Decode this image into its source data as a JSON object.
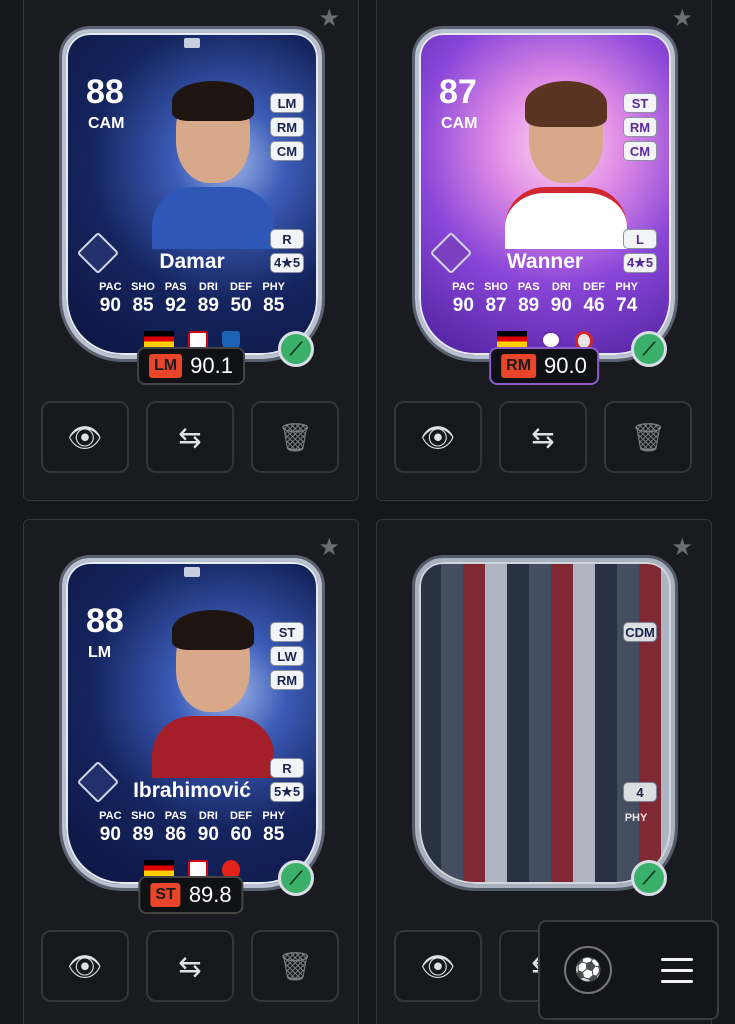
{
  "cards": [
    {
      "name": "Damar",
      "ovr": "88",
      "pos": "CAM",
      "alt_positions": [
        "LM",
        "RM",
        "CM"
      ],
      "foot": "R",
      "skills": "4★5",
      "stats": [
        {
          "label": "PAC",
          "value": "90"
        },
        {
          "label": "SHO",
          "value": "85"
        },
        {
          "label": "PAS",
          "value": "92"
        },
        {
          "label": "DRI",
          "value": "89"
        },
        {
          "label": "DEF",
          "value": "50"
        },
        {
          "label": "PHY",
          "value": "85"
        }
      ],
      "pill_pos": "LM",
      "pill_rating": "90.1"
    },
    {
      "name": "Wanner",
      "ovr": "87",
      "pos": "CAM",
      "alt_positions": [
        "ST",
        "RM",
        "CM"
      ],
      "foot": "L",
      "skills": "4★5",
      "stats": [
        {
          "label": "PAC",
          "value": "90"
        },
        {
          "label": "SHO",
          "value": "87"
        },
        {
          "label": "PAS",
          "value": "89"
        },
        {
          "label": "DRI",
          "value": "90"
        },
        {
          "label": "DEF",
          "value": "46"
        },
        {
          "label": "PHY",
          "value": "74"
        }
      ],
      "pill_pos": "RM",
      "pill_rating": "90.0"
    },
    {
      "name": "Ibrahimović",
      "ovr": "88",
      "pos": "LM",
      "alt_positions": [
        "ST",
        "LW",
        "RM"
      ],
      "foot": "R",
      "skills": "5★5",
      "stats": [
        {
          "label": "PAC",
          "value": "90"
        },
        {
          "label": "SHO",
          "value": "89"
        },
        {
          "label": "PAS",
          "value": "86"
        },
        {
          "label": "DRI",
          "value": "90"
        },
        {
          "label": "DEF",
          "value": "60"
        },
        {
          "label": "PHY",
          "value": "85"
        }
      ],
      "pill_pos": "ST",
      "pill_rating": "89.8"
    },
    {
      "alt_positions": [
        "CDM"
      ],
      "skills": "4",
      "stat_label": "PHY"
    }
  ],
  "icons": {
    "star": "★",
    "view": "👁",
    "swap": "⇆",
    "trash": "🗑",
    "evo": "⟋"
  }
}
